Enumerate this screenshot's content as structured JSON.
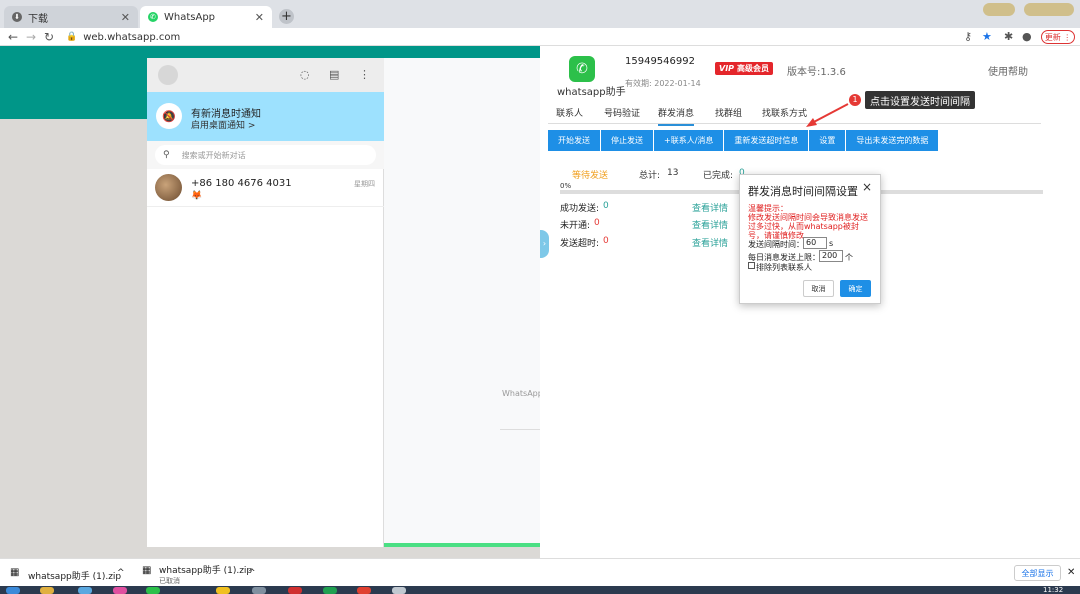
{
  "browser": {
    "tabs": [
      {
        "label": "下载",
        "active": false
      },
      {
        "label": "WhatsApp",
        "active": true
      }
    ],
    "new_tab": "+",
    "url": "web.whatsapp.com",
    "update_label": "更新",
    "nav_icons": [
      "back-icon",
      "forward-icon",
      "reload-icon"
    ],
    "toolbar_icons": [
      "key-icon",
      "star-icon",
      "extension-icon",
      "profile-icon",
      "menu-icon"
    ]
  },
  "whatsapp": {
    "notify": {
      "title": "有新消息时通知",
      "subtitle": "启用桌面通知 >"
    },
    "search_placeholder": "搜索或开始新对话",
    "chats": [
      {
        "name": "+86 180 4676 4031",
        "time": "星期四",
        "preview": "🦊"
      }
    ],
    "watermark": "WhatsApp"
  },
  "plugin": {
    "logo_text": "whatsapp助手",
    "phone": "15949546992",
    "expiry": "有效期: 2022-01-14",
    "vip_badge": "VIP",
    "vip_label": "高级会员",
    "version": "版本号:1.3.6",
    "help": "使用帮助",
    "tabs": [
      {
        "label": "联系人",
        "active": false
      },
      {
        "label": "号码验证",
        "active": false
      },
      {
        "label": "群发消息",
        "active": true
      },
      {
        "label": "找群组",
        "active": false
      },
      {
        "label": "找联系方式",
        "active": false
      }
    ],
    "actions": [
      "开始发送",
      "停止发送",
      "+联系人/消息",
      "重新发送超时信息",
      "设置",
      "导出未发送完的数据"
    ],
    "status": {
      "waiting": "等待发送",
      "total_label": "总计:",
      "total": "13",
      "done_label": "已完成:",
      "done": "0",
      "progress_text": "0%",
      "progress": 0
    },
    "results": [
      {
        "label": "成功发送:",
        "value": "0",
        "color": "#2aa198",
        "link": "查看详情"
      },
      {
        "label": "未开通:",
        "value": "0",
        "color": "#e53935",
        "link": "查看详情"
      },
      {
        "label": "发送超时:",
        "value": "0",
        "color": "#e53935",
        "link": "查看详情"
      }
    ],
    "annotation": {
      "number": "1",
      "text": "点击设置发送时间间隔"
    }
  },
  "dialog": {
    "title": "群发消息时间间隔设置",
    "close": "×",
    "warning_title": "温馨提示：",
    "warning_body": "修改发送间隔时间会导致消息发送过多过快，从而whatsapp被封号，请谨慎修改",
    "interval_label": "发送间隔时间：",
    "interval_value": "60",
    "interval_unit": "s",
    "limit_label": "每日消息发送上限：",
    "limit_value": "200",
    "limit_unit": "个",
    "exclude_label": "排除列表联系人",
    "cancel": "取消",
    "confirm": "确定"
  },
  "downloads": [
    {
      "name": "whatsapp助手 (1).zip",
      "sub": ""
    },
    {
      "name": "whatsapp助手 (1).zip",
      "sub": "已取消"
    }
  ],
  "downloads_show_all": "全部显示",
  "taskbar_time": "11:32",
  "colors": {
    "teal": "#009688",
    "accent": "#1e8fe6",
    "vip": "#e4262b",
    "notify": "#9de1fe"
  }
}
